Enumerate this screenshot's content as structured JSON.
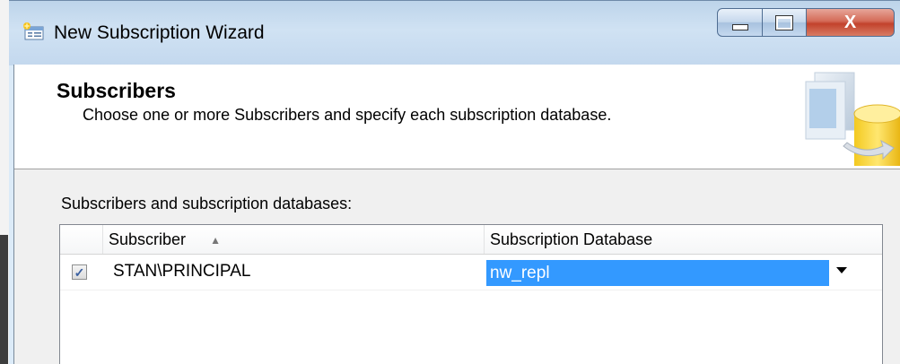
{
  "window": {
    "title": "New Subscription Wizard",
    "close_glyph": "X"
  },
  "header": {
    "title": "Subscribers",
    "subtitle": "Choose one or more Subscribers and specify each subscription database."
  },
  "list": {
    "label": "Subscribers and subscription databases:",
    "columns": [
      "Subscriber",
      "Subscription Database"
    ],
    "sort_glyph": "▲",
    "rows": [
      {
        "checked": true,
        "subscriber": "STAN\\PRINCIPAL",
        "database": "nw_repl"
      }
    ]
  },
  "colors": {
    "selection": "#3399ff",
    "close_button": "#c2422c"
  },
  "icons": [
    "wizard-app-icon",
    "minimize-icon",
    "maximize-icon",
    "close-icon",
    "checkbox-check-icon",
    "dropdown-arrow-icon",
    "database-wizard-graphic"
  ]
}
